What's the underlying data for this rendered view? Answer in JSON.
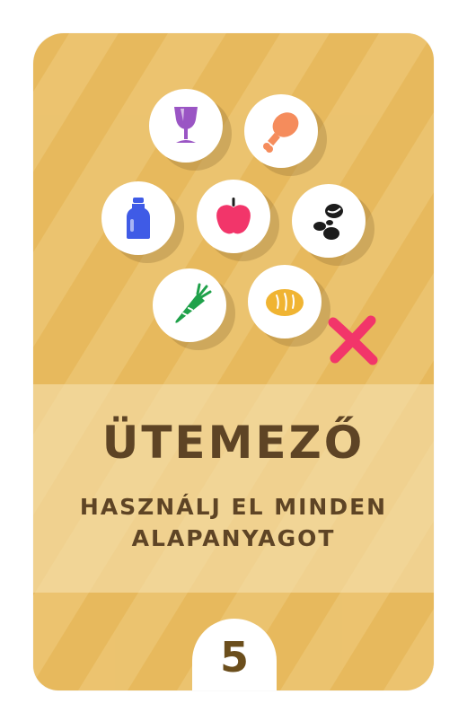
{
  "card": {
    "title": "ÜTEMEZŐ",
    "subtitle_line1": "HASZNÁLJ EL MINDEN",
    "subtitle_line2": "ALAPANYAGOT",
    "number": "5"
  },
  "icons": [
    {
      "name": "wine-glass-icon",
      "color": "#9a55c4"
    },
    {
      "name": "chicken-leg-icon",
      "color": "#f58c5c"
    },
    {
      "name": "milk-bottle-icon",
      "color": "#3f5be6"
    },
    {
      "name": "apple-icon",
      "color": "#f2356a"
    },
    {
      "name": "coffee-beans-icon",
      "color": "#1c1c1c"
    },
    {
      "name": "carrot-icon",
      "color": "#1fa14a"
    },
    {
      "name": "bread-icon",
      "color": "#f0b432"
    }
  ],
  "colors": {
    "card_background": "#e7b95d",
    "band": "#f5e1af",
    "text": "#5e4425",
    "cross": "#f2356a"
  }
}
